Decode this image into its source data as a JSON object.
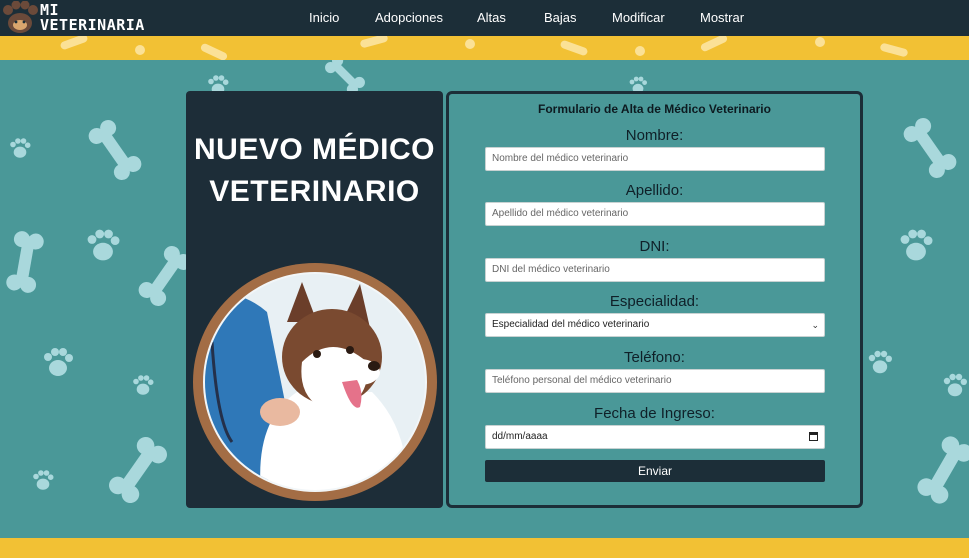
{
  "brand": {
    "line1": "MI",
    "line2": "VETERINARIA",
    "logo_icon": "paw-icon"
  },
  "nav": {
    "items": [
      {
        "label": "Inicio"
      },
      {
        "label": "Adopciones"
      },
      {
        "label": "Altas"
      },
      {
        "label": "Bajas"
      },
      {
        "label": "Modificar"
      },
      {
        "label": "Mostrar"
      }
    ]
  },
  "hero": {
    "title_line1": "NUEVO MÉDICO",
    "title_line2": "VETERINARIO",
    "image": "husky-dog-with-vet-photo"
  },
  "form": {
    "title": "Formulario de Alta de Médico Veterinario",
    "fields": [
      {
        "label": "Nombre:",
        "placeholder": "Nombre del médico veterinario"
      },
      {
        "label": "Apellido:",
        "placeholder": "Apellido del médico veterinario"
      },
      {
        "label": "DNI:",
        "placeholder": "DNI del médico veterinario"
      },
      {
        "label": "Especialidad:",
        "value": "Especialidad del médico veterinario"
      },
      {
        "label": "Teléfono:",
        "placeholder": "Teléfono personal del médico veterinario"
      },
      {
        "label": "Fecha de Ingreso:",
        "value": "dd/mm/aaaa"
      }
    ],
    "submit_label": "Enviar"
  },
  "colors": {
    "nav_bg": "#1c2e38",
    "page_bg": "#4a9898",
    "stripe": "#f2c134",
    "deco": "#a9d8dc"
  }
}
